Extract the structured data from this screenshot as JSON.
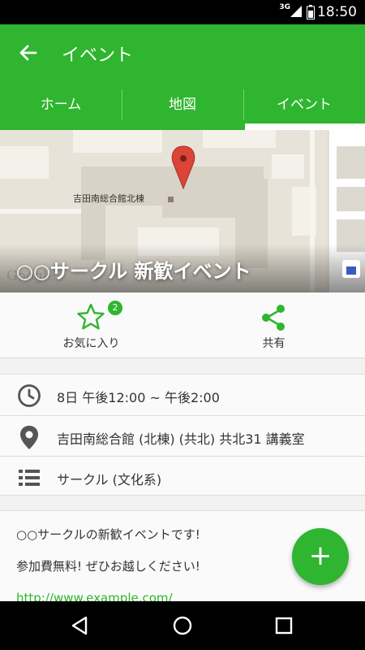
{
  "status_bar": {
    "network": "3G",
    "time": "18:50"
  },
  "app_bar": {
    "title": "イベント",
    "back_icon": "arrow-left-icon"
  },
  "tabs": [
    {
      "label": "ホーム",
      "active": false
    },
    {
      "label": "地図",
      "active": false
    },
    {
      "label": "イベント",
      "active": true
    }
  ],
  "map": {
    "building_label": "吉田南総合館北棟",
    "event_title": "○○サークル 新歓イベント",
    "watermark": "Google"
  },
  "actions": {
    "favorite_label": "お気に入り",
    "favorite_count": "2",
    "share_label": "共有"
  },
  "details": {
    "datetime": "8日 午後12:00 ~ 午後2:00",
    "location": "吉田南総合館 (北棟) (共北) 共北31 講義室",
    "category": "サークル (文化系)"
  },
  "description": {
    "line1": "○○サークルの新歓イベントです!",
    "line2": "参加費無料! ぜひお越しください!",
    "link": "http://www.example.com/"
  },
  "fab": {
    "label": "+"
  },
  "colors": {
    "accent": "#2fb52f",
    "pin": "#db4437"
  }
}
